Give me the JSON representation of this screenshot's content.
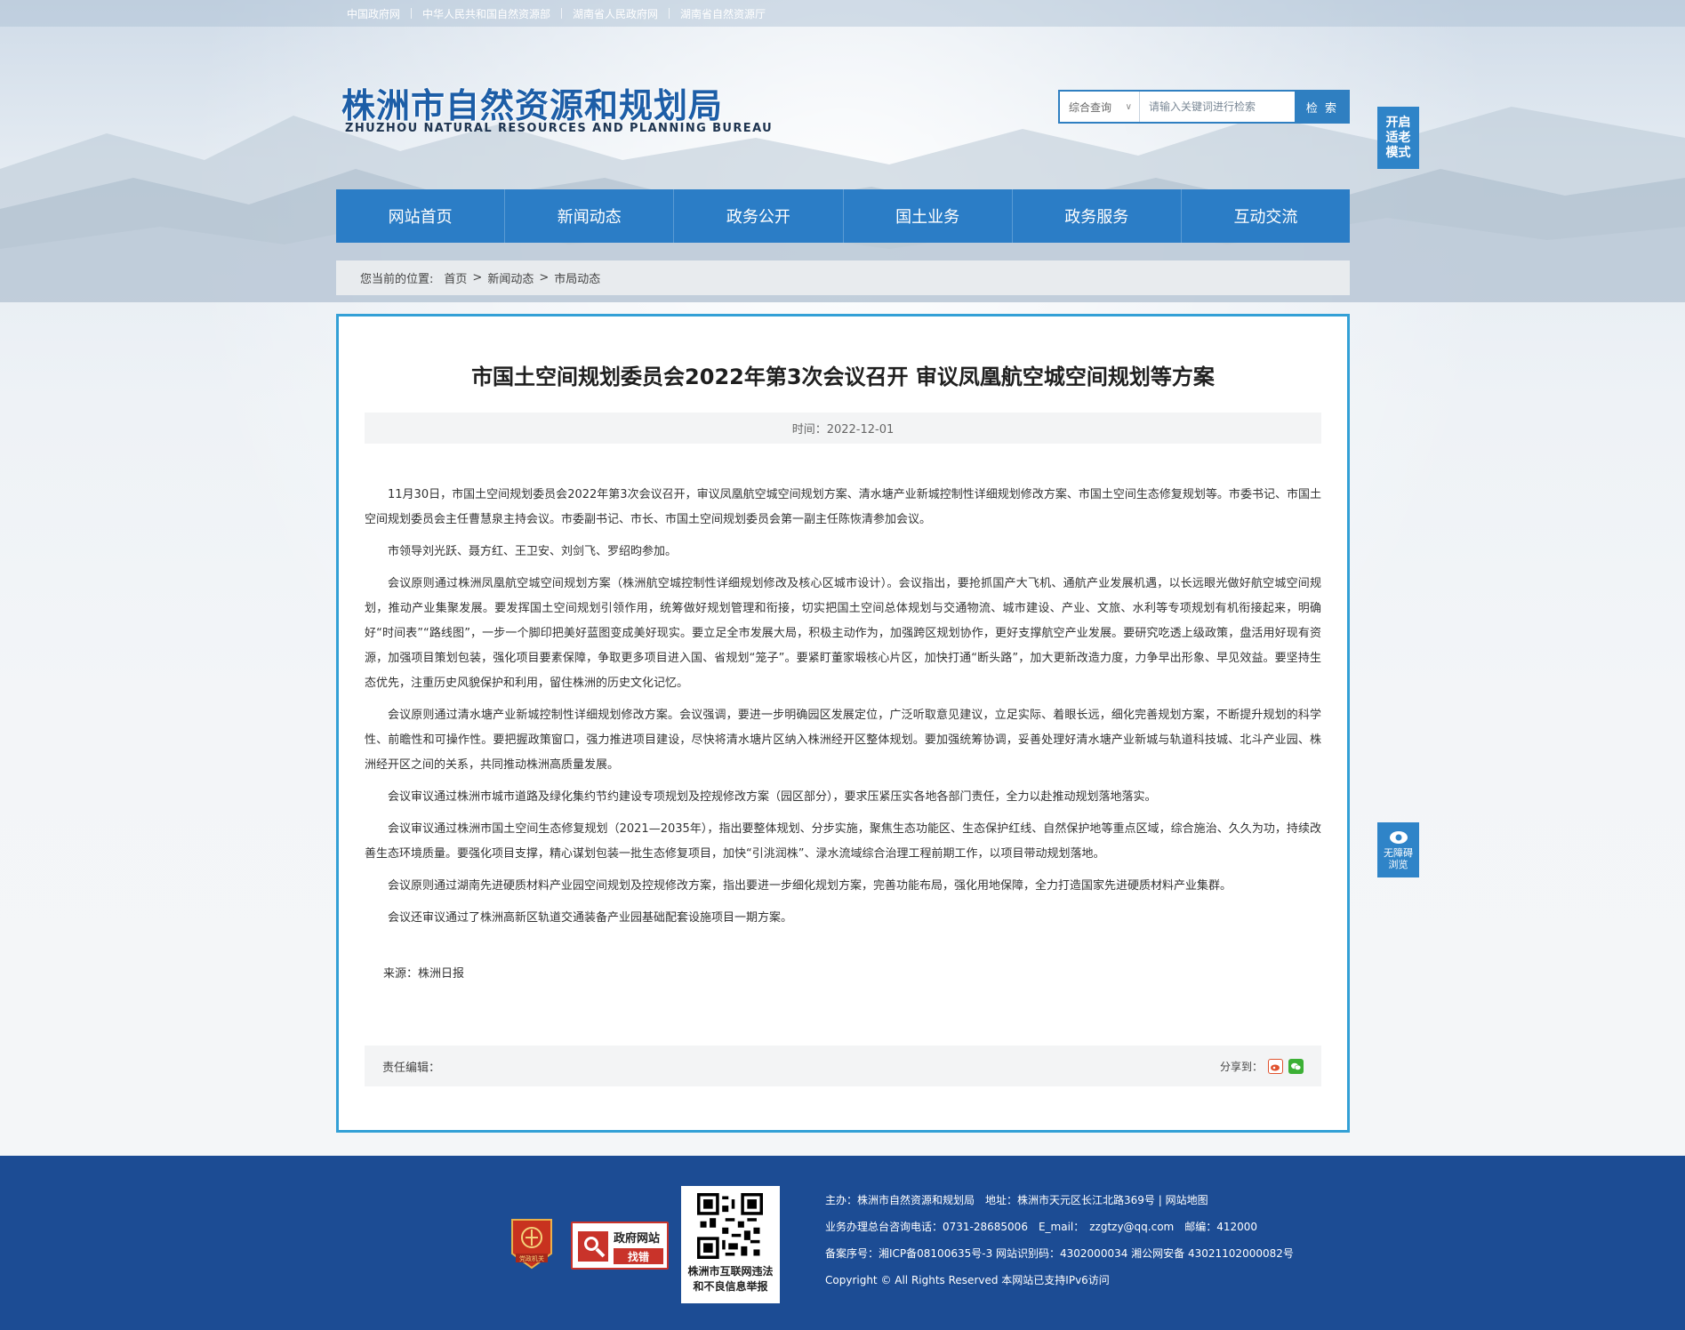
{
  "top_links": [
    "中国政府网",
    "中华人民共和国自然资源部",
    "湖南省人民政府网",
    "湖南省自然资源厅"
  ],
  "logo": {
    "cn": "株洲市自然资源和规划局",
    "en": "ZHUZHOU NATURAL RESOURCES AND PLANNING BUREAU"
  },
  "search": {
    "scope": "综合查询",
    "placeholder": "请输入关键词进行检索",
    "button": "检 索"
  },
  "side": {
    "elder_mode": "开启适老模式",
    "accessibility": [
      "无障碍",
      "浏览"
    ]
  },
  "nav": [
    "网站首页",
    "新闻动态",
    "政务公开",
    "国土业务",
    "政务服务",
    "互动交流"
  ],
  "breadcrumb": {
    "label": "您当前的位置:",
    "items": [
      "首页",
      ">",
      "新闻动态",
      ">",
      "市局动态"
    ]
  },
  "article": {
    "title": "市国土空间规划委员会2022年第3次会议召开 审议凤凰航空城空间规划等方案",
    "time": "时间：2022-12-01",
    "paragraphs": [
      "11月30日，市国土空间规划委员会2022年第3次会议召开，审议凤凰航空城空间规划方案、清水塘产业新城控制性详细规划修改方案、市国土空间生态修复规划等。市委书记、市国土空间规划委员会主任曹慧泉主持会议。市委副书记、市长、市国土空间规划委员会第一副主任陈恢清参加会议。",
      "市领导刘光跃、聂方红、王卫安、刘剑飞、罗绍昀参加。",
      "会议原则通过株洲凤凰航空城空间规划方案（株洲航空城控制性详细规划修改及核心区城市设计）。会议指出，要抢抓国产大飞机、通航产业发展机遇，以长远眼光做好航空城空间规划，推动产业集聚发展。要发挥国土空间规划引领作用，统筹做好规划管理和衔接，切实把国土空间总体规划与交通物流、城市建设、产业、文旅、水利等专项规划有机衔接起来，明确好“时间表”“路线图”，一步一个脚印把美好蓝图变成美好现实。要立足全市发展大局，积极主动作为，加强跨区规划协作，更好支撑航空产业发展。要研究吃透上级政策，盘活用好现有资源，加强项目策划包装，强化项目要素保障，争取更多项目进入国、省规划“笼子”。要紧盯董家塅核心片区，加快打通“断头路”，加大更新改造力度，力争早出形象、早见效益。要坚持生态优先，注重历史风貌保护和利用，留住株洲的历史文化记忆。",
      "会议原则通过清水塘产业新城控制性详细规划修改方案。会议强调，要进一步明确园区发展定位，广泛听取意见建议，立足实际、着眼长远，细化完善规划方案，不断提升规划的科学性、前瞻性和可操作性。要把握政策窗口，强力推进项目建设，尽快将清水塘片区纳入株洲经开区整体规划。要加强统筹协调，妥善处理好清水塘产业新城与轨道科技城、北斗产业园、株洲经开区之间的关系，共同推动株洲高质量发展。",
      "会议审议通过株洲市城市道路及绿化集约节约建设专项规划及控规修改方案（园区部分），要求压紧压实各地各部门责任，全力以赴推动规划落地落实。",
      "会议审议通过株洲市国土空间生态修复规划（2021—2035年），指出要整体规划、分步实施，聚焦生态功能区、生态保护红线、自然保护地等重点区域，综合施治、久久为功，持续改善生态环境质量。要强化项目支撑，精心谋划包装一批生态修复项目，加快“引洮润株”、渌水流域综合治理工程前期工作，以项目带动规划落地。",
      "会议原则通过湖南先进硬质材料产业园空间规划及控规修改方案，指出要进一步细化规划方案，完善功能布局，强化用地保障，全力打造国家先进硬质材料产业集群。",
      "会议还审议通过了株洲高新区轨道交通装备产业园基础配套设施项目一期方案。"
    ],
    "source": "来源：株洲日报",
    "editor": "责任编辑：",
    "share": "分享到："
  },
  "footer": {
    "badge_party": "党政机关",
    "badge_gov": [
      "政府网站",
      "找错"
    ],
    "qr_caption": [
      "株洲市互联网违法",
      "和不良信息举报"
    ],
    "rows": [
      "主办：株洲市自然资源和规划局　地址：株洲市天元区长江北路369号 | 网站地图",
      "业务办理总台咨询电话：0731-28685006　E_mail：　zzgtzy@qq.com　邮编：412000",
      "备案序号：湘ICP备08100635号-3 网站识别码：4302000034  湘公网安备 43021102000082号",
      "Copyright © All Rights Reserved 本网站已支持IPv6访问"
    ]
  },
  "colors": {
    "brand_blue": "#2b7dc6",
    "footer_blue": "#1c4c94",
    "article_border": "#33a0d6"
  }
}
